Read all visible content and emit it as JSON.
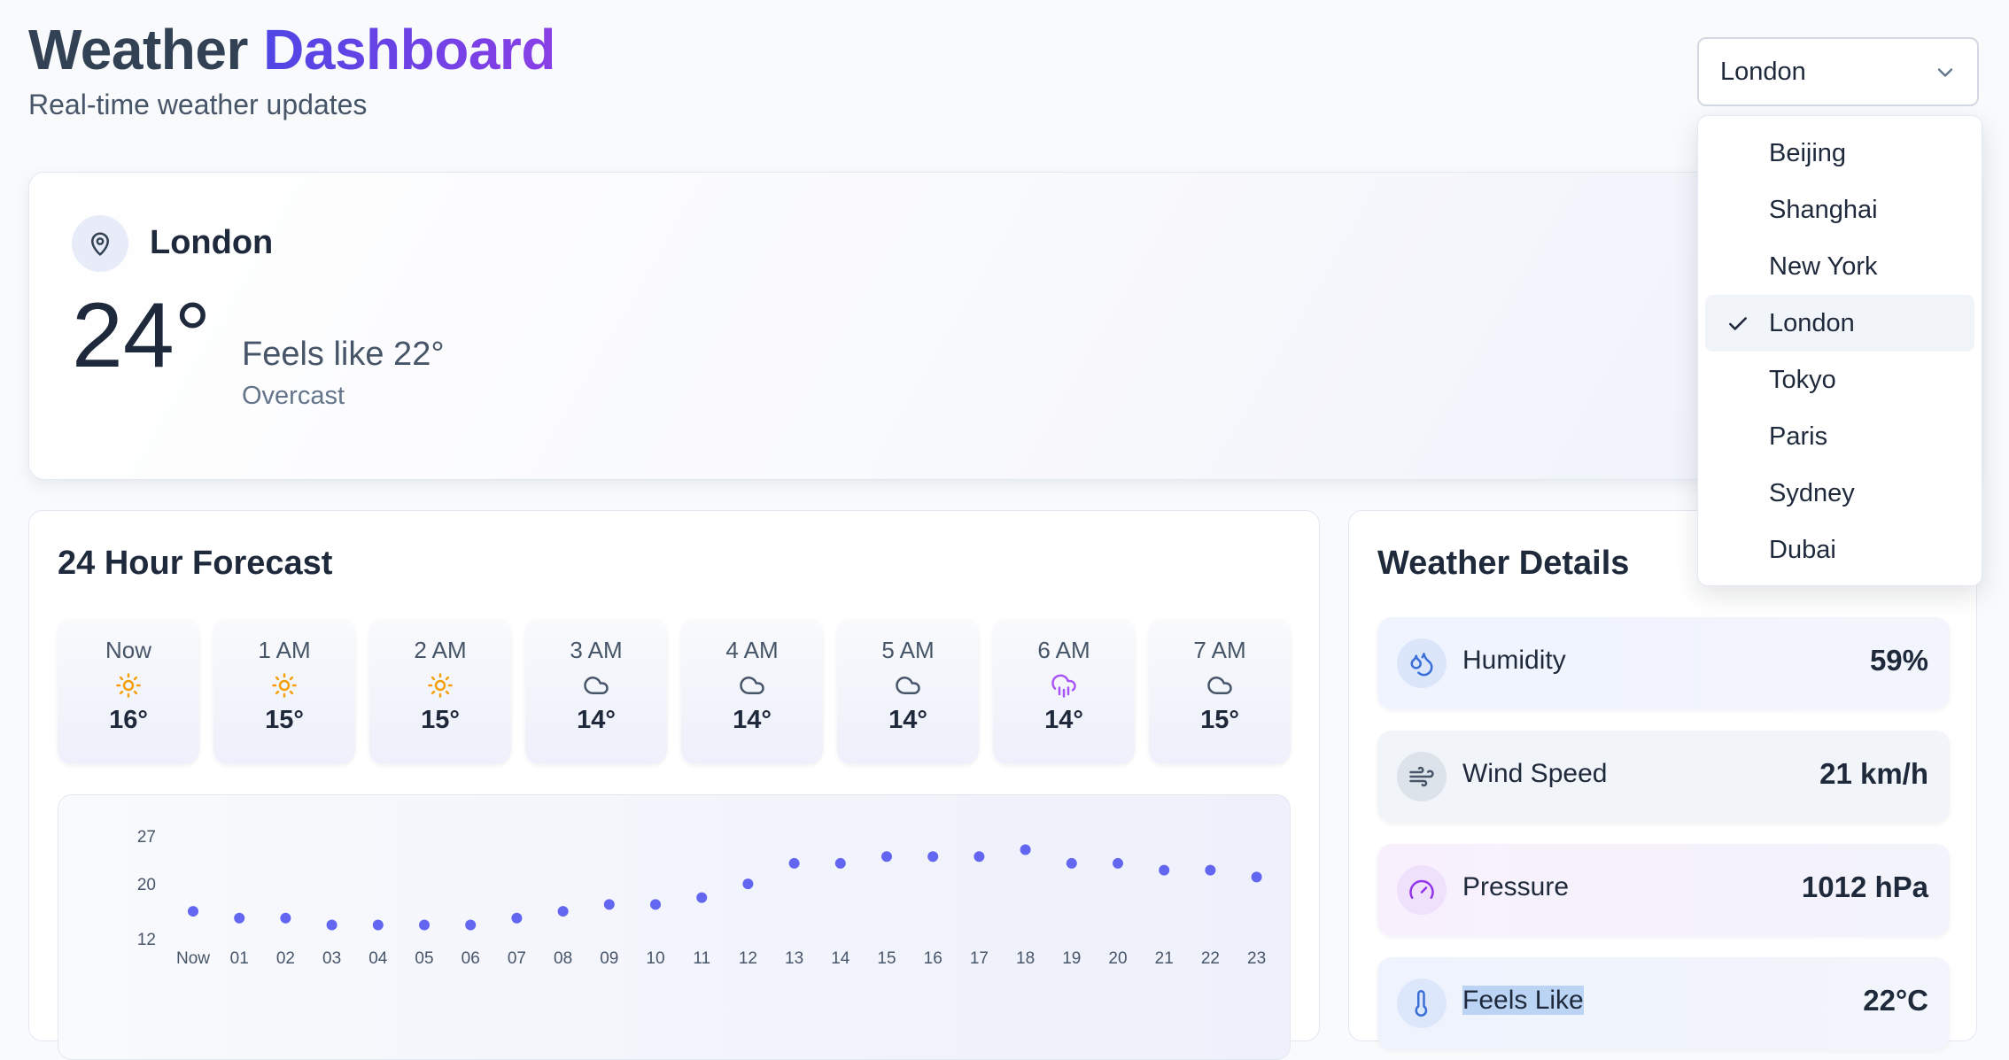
{
  "header": {
    "title_part1": "Weather",
    "title_part2": "Dashboard",
    "subtitle": "Real-time weather updates"
  },
  "city_select": {
    "selected": "London",
    "options": [
      "Beijing",
      "Shanghai",
      "New York",
      "London",
      "Tokyo",
      "Paris",
      "Sydney",
      "Dubai"
    ]
  },
  "current": {
    "city": "London",
    "temp": "24°",
    "feels_like": "Feels like 22°",
    "condition": "Overcast"
  },
  "forecast": {
    "title": "24 Hour Forecast",
    "hours": [
      {
        "label": "Now",
        "icon": "sun-icon",
        "temp": "16°"
      },
      {
        "label": "1 AM",
        "icon": "sun-icon",
        "temp": "15°"
      },
      {
        "label": "2 AM",
        "icon": "sun-icon",
        "temp": "15°"
      },
      {
        "label": "3 AM",
        "icon": "cloud-icon",
        "temp": "14°"
      },
      {
        "label": "4 AM",
        "icon": "cloud-icon",
        "temp": "14°"
      },
      {
        "label": "5 AM",
        "icon": "cloud-icon",
        "temp": "14°"
      },
      {
        "label": "6 AM",
        "icon": "cloud-rain-icon",
        "temp": "14°"
      },
      {
        "label": "7 AM",
        "icon": "cloud-icon",
        "temp": "15°"
      }
    ]
  },
  "details": {
    "title": "Weather Details",
    "rows": [
      {
        "label": "Humidity",
        "value": "59%",
        "icon": "droplets-icon"
      },
      {
        "label": "Wind Speed",
        "value": "21 km/h",
        "icon": "wind-icon"
      },
      {
        "label": "Pressure",
        "value": "1012 hPa",
        "icon": "gauge-icon"
      },
      {
        "label": "Feels Like",
        "value": "22°C",
        "icon": "thermometer-icon"
      }
    ]
  },
  "colors": {
    "accent": "#6366f1",
    "sun": "#f59e0b",
    "rain": "#a855f7",
    "title_dark": "#334155"
  },
  "chart_data": {
    "type": "scatter",
    "x": [
      "Now",
      "01",
      "02",
      "03",
      "04",
      "05",
      "06",
      "07",
      "08",
      "09",
      "10",
      "11",
      "12",
      "13",
      "14",
      "15",
      "16",
      "17",
      "18",
      "19",
      "20",
      "21",
      "22",
      "23"
    ],
    "values": [
      16,
      15,
      15,
      14,
      14,
      14,
      14,
      15,
      16,
      17,
      17,
      18,
      20,
      23,
      23,
      24,
      24,
      24,
      25,
      23,
      23,
      22,
      22,
      21
    ],
    "ytick_labels": [
      "12",
      "20",
      "27"
    ],
    "ylim": [
      12,
      27
    ],
    "grid": false
  }
}
